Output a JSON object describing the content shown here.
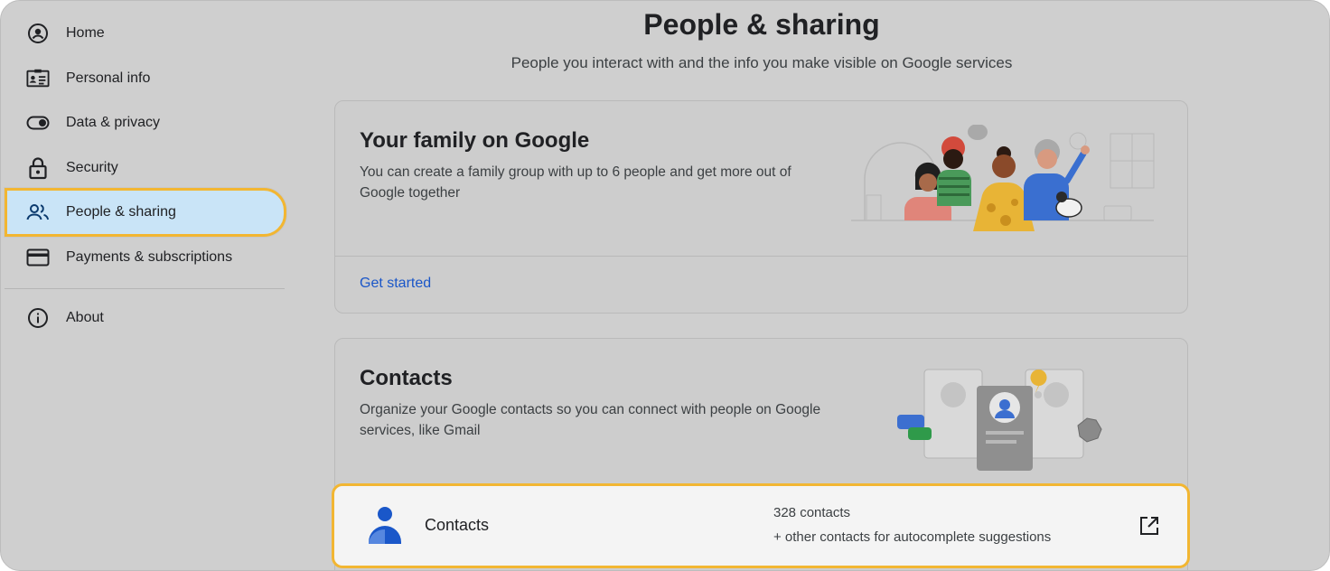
{
  "sidebar": {
    "items": [
      {
        "label": "Home",
        "icon": "account-circle-icon"
      },
      {
        "label": "Personal info",
        "icon": "id-card-icon"
      },
      {
        "label": "Data & privacy",
        "icon": "toggle-icon"
      },
      {
        "label": "Security",
        "icon": "lock-icon"
      },
      {
        "label": "People & sharing",
        "icon": "people-icon",
        "active": true
      },
      {
        "label": "Payments & subscriptions",
        "icon": "credit-card-icon"
      },
      {
        "label": "About",
        "icon": "info-icon"
      }
    ]
  },
  "header": {
    "title": "People & sharing",
    "subtitle": "People you interact with and the info you make visible on Google services"
  },
  "family_card": {
    "title": "Your family on Google",
    "description": "You can create a family group with up to 6 people and get more out of Google together",
    "link": "Get started",
    "illustration": "family-group-illustration"
  },
  "contacts_card": {
    "title": "Contacts",
    "description": "Organize your Google contacts so you can connect with people on Google services, like Gmail",
    "illustration": "contacts-cards-illustration",
    "row": {
      "label": "Contacts",
      "count": "328 contacts",
      "note": "+ other contacts for autocomplete suggestions",
      "icon": "person-icon",
      "action_icon": "open-in-new-icon"
    }
  },
  "colors": {
    "highlight_border": "#f2b632",
    "active_nav_bg": "#c9e4f7",
    "link": "#1a56c8",
    "background": "#cfcfcf"
  }
}
